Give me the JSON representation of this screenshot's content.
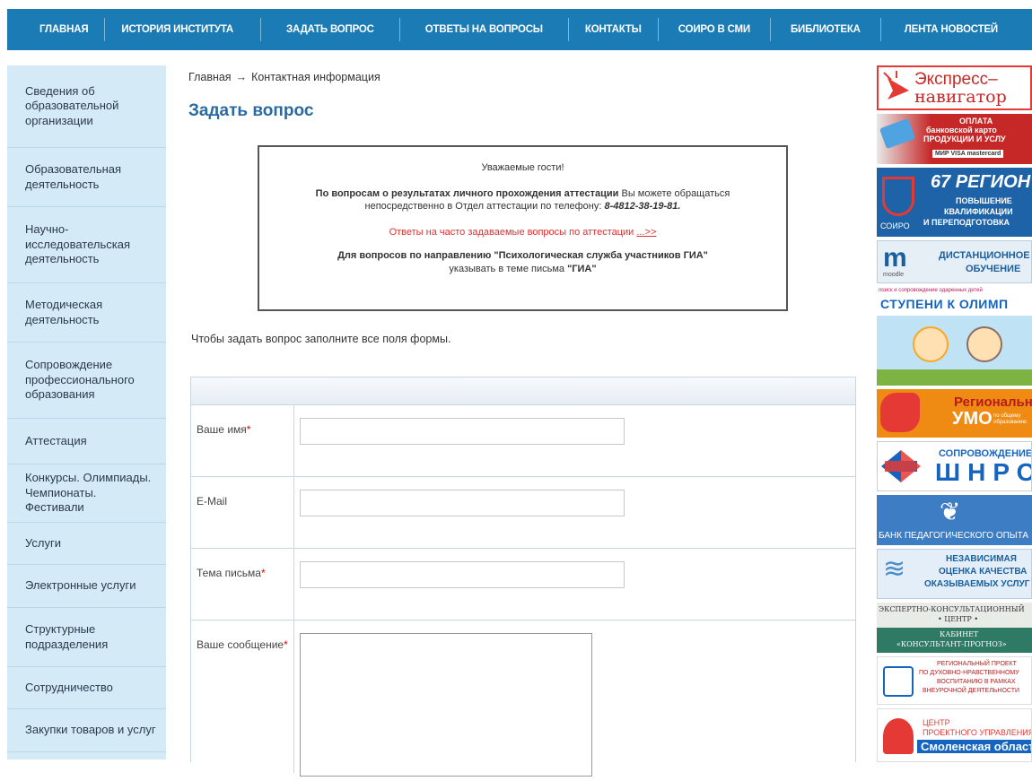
{
  "nav": {
    "items": [
      "ГЛАВНАЯ",
      "ИСТОРИЯ ИНСТИТУТА",
      "ЗАДАТЬ ВОПРОС",
      "ОТВЕТЫ НА ВОПРОСЫ",
      "КОНТАКТЫ",
      "СОИРО В СМИ",
      "БИБЛИОТЕКА",
      "ЛЕНТА НОВОСТЕЙ"
    ]
  },
  "sidebar": {
    "items": [
      "Сведения об образовательной организации",
      "Образовательная деятельность",
      "Научно-исследовательская деятельность",
      "Методическая деятельность",
      "Сопровождение профессионального образования",
      "Аттестация",
      "Конкурсы. Олимпиады. Чемпионаты. Фестивали",
      "Услуги",
      "Электронные услуги",
      "Структурные подразделения",
      "Сотрудничество",
      "Закупки товаров и услуг"
    ]
  },
  "breadcrumb": {
    "home": "Главная",
    "arrow": "→",
    "current": "Контактная информация"
  },
  "page": {
    "title": "Задать вопрос"
  },
  "notice": {
    "greeting": "Уважаемые гости!",
    "p1_bold": "По вопросам о результатах личного прохождения аттестации",
    "p1_rest": " Вы можете обращаться",
    "p1_line2": "непосредственно в  Отдел аттестации по телефону: ",
    "phone": "8-4812-38-19-81.",
    "faq_text": "Ответы на часто задаваемые вопросы по аттестации ",
    "faq_link": "...>>",
    "p3_bold": "Для вопросов по направлению \"Психологическая служба участников ГИА\"",
    "p3_line2": "указывать в теме письма ",
    "p3_tag": "\"ГИА\""
  },
  "instruction": "Чтобы задать вопрос заполните все поля формы.",
  "form": {
    "name_label": "Ваше имя",
    "email_label": "E-Mail",
    "subject_label": "Тема письма",
    "message_label": "Ваше сообщение",
    "required_mark": "*"
  },
  "banners": {
    "b1_line1": "Экспресс–",
    "b1_line2": "навигатор",
    "b2_line1": "ОПЛАТА",
    "b2_line2": "банковской карто",
    "b2_line3": "ПРОДУКЦИИ И УСЛУ",
    "b2_cards": "МИР  VISA  mastercard",
    "b3_title": "67 РЕГИОН",
    "b3_line1": "ПОВЫШЕНИЕ",
    "b3_line2": "КВАЛИФИКАЦИИ",
    "b3_line3": "И ПЕРЕПОДГОТОВКА",
    "b3_logo": "СОИРО",
    "b4_line1": "ДИСТАНЦИОННОЕ",
    "b4_line2": "ОБУЧЕНИЕ",
    "b4_logo": "moodle",
    "b5_small": "поиск и сопровождение одаренных детей",
    "b5_title": "СТУПЕНИ К ОЛИМП",
    "b6_line1": "Региональное",
    "b6_line2": "УМО",
    "b6_line3": "по общему образованию",
    "b7_line1": "СОПРОВОЖДЕНИЕ",
    "b7_line2": "ШНРО",
    "b8_text": "БАНК ПЕДАГОГИЧЕСКОГО ОПЫТА",
    "b9_line1": "НЕЗАВИСИМАЯ",
    "b9_line2": "ОЦЕНКА КАЧЕСТВА",
    "b9_line3": "ОКАЗЫВАЕМЫХ УСЛУГ",
    "b10_line1": "ЭКСПЕРТНО-КОНСУЛЬТАЦИОННЫЙ",
    "b10_line2": "• ЦЕНТР •",
    "b10_line3": "КАБИНЕТ",
    "b10_line4": "«КОНСУЛЬТАНТ-ПРОГНОЗ»",
    "b11_line1": "РЕГИОНАЛЬНЫЙ ПРОЕКТ",
    "b11_line2": "ПО ДУХОВНО-НРАВСТВЕННОМУ",
    "b11_line3": "ВОСПИТАНИЮ В РАМКАХ",
    "b11_line4": "ВНЕУРОЧНОЙ ДЕЯТЕЛЬНОСТИ",
    "b12_line1": "ЦЕНТР",
    "b12_line2": "ПРОЕКТНОГО УПРАВЛЕНИЯ",
    "b12_line3": "Смоленская область"
  },
  "colors": {
    "nav_bg": "#1a7bb5",
    "sidebar_bg": "#d5eaf7",
    "title": "#2a6aa0",
    "required": "#dd0000"
  }
}
